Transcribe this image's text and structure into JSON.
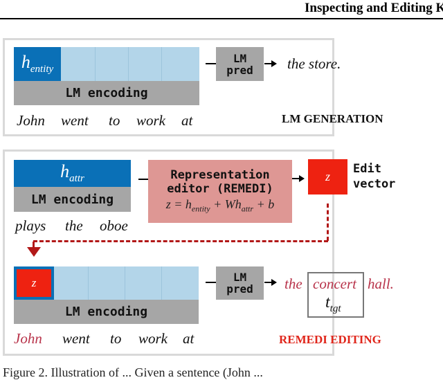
{
  "header": {
    "title": "Inspecting and Editing Knowledge Re"
  },
  "top_panel": {
    "label": "LM GENERATION",
    "entity_cell": {
      "base": "h",
      "sub": "entity"
    },
    "encoding_label": "LM encoding",
    "tokens": [
      "John",
      "went",
      "to",
      "work",
      "at"
    ],
    "pred_box": {
      "line1": "LM",
      "line2": "pred"
    },
    "output": "the store."
  },
  "editor_panel": {
    "label": "REMEDI EDITING",
    "attr_cell": {
      "base": "h",
      "sub": "attr"
    },
    "attr_encoding_label": "LM encoding",
    "attr_tokens": [
      "plays",
      "the",
      "oboe"
    ],
    "editor_box": {
      "line1": "Representation",
      "line2": "editor (REMEDI)",
      "formula": {
        "lhs": "z = ",
        "h": "h",
        "h_sub": "entity",
        "plus1": " + W",
        "h2": "h",
        "h2_sub": "attr",
        "plus2": " + b"
      }
    },
    "z_label": "z",
    "edit_vector_label": {
      "line1": "Edit",
      "line2": "vector"
    },
    "edited_z_label": "z",
    "edited_encoding_label": "LM encoding",
    "edited_tokens": [
      "John",
      "went",
      "to",
      "work",
      "at"
    ],
    "pred_box": {
      "line1": "LM",
      "line2": "pred"
    },
    "output": {
      "before": "the",
      "target": "concert",
      "after": "hall.",
      "target_label_base": "t",
      "target_label_sub": "tgt"
    }
  },
  "colors": {
    "entity_blue": "#0a70b7",
    "light_blue": "#b3d5e9",
    "gray": "#a6a6a6",
    "editor_pink": "#de9794",
    "edit_red": "#ee2211",
    "dash_red": "#b21818",
    "highlight_text": "#b8334a",
    "remedi_label": "#e0261b"
  },
  "caption": {
    "text": "Figure 2. Illustration of ... Given a sentence (John ..."
  }
}
